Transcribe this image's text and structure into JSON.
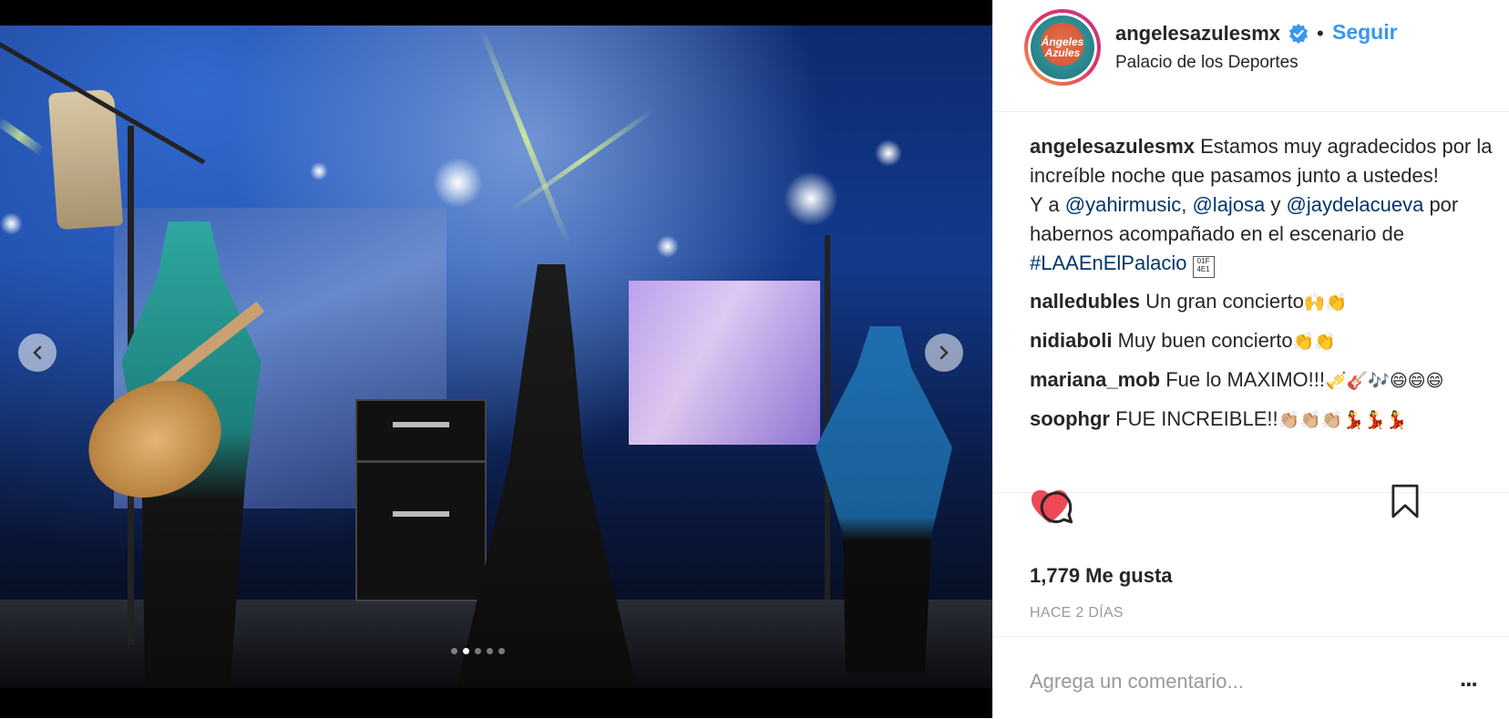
{
  "post": {
    "username": "angelesazulesmx",
    "follow_label": "Seguir",
    "bullet": "•",
    "location": "Palacio de los Deportes",
    "avatar_text": "Ángeles Azules"
  },
  "caption": {
    "username": "angelesazulesmx",
    "text_1": "Estamos muy agradecidos por la increíble noche que pasamos junto a ustedes!",
    "text_2": "Y a",
    "mention_1": "@yahirmusic",
    "sep_1": ",",
    "mention_2": "@lajosa",
    "sep_2": "y",
    "mention_3": "@jaydelacueva",
    "text_3": "por habernos acompañado en el escenario de",
    "hashtag": "#LAAEnElPalacio",
    "box_glyph": "01F 4E1"
  },
  "comments": [
    {
      "user": "nalledubles",
      "text": "Un gran concierto",
      "emoji": "🙌👏"
    },
    {
      "user": "nidiaboli",
      "text": "Muy buen concierto",
      "emoji": "👏👏"
    },
    {
      "user": "mariana_mob",
      "text": "Fue lo MAXIMO!!!",
      "emoji": "🎺🎸🎶😄😄😄"
    },
    {
      "user": "soophgr",
      "text": "FUE INCREIBLE!!",
      "emoji": "👏🏼👏🏼👏🏼💃💃💃"
    }
  ],
  "actions": {
    "like_icon": "heart-icon",
    "comment_icon": "comment-icon",
    "save_icon": "bookmark-icon",
    "liked_color": "#ed4956"
  },
  "likes_label": "1,779 Me gusta",
  "timestamp": "HACE 2 DÍAS",
  "add_comment": {
    "placeholder": "Agrega un comentario...",
    "more_label": "..."
  },
  "carousel": {
    "count": 5,
    "active_index": 2
  },
  "colors": {
    "link": "#003569",
    "follow": "#3897f0",
    "muted": "#999999"
  }
}
